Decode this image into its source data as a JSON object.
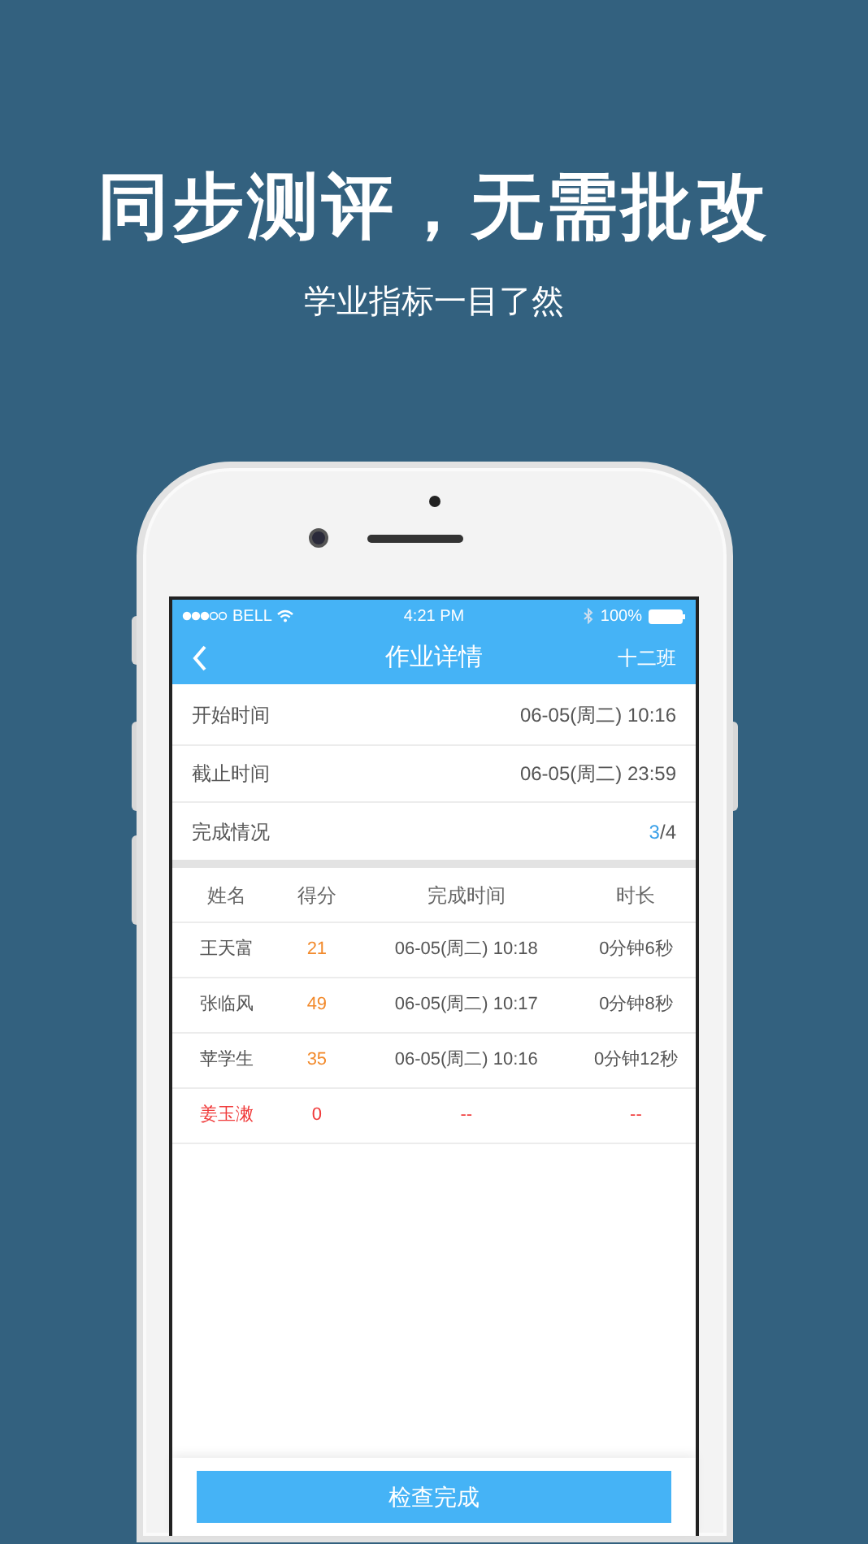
{
  "headline": "同步测评，无需批改",
  "subheadline": "学业指标一目了然",
  "status_bar": {
    "carrier": "BELL",
    "time": "4:21 PM",
    "battery": "100%"
  },
  "nav": {
    "title": "作业详情",
    "right": "十二班"
  },
  "info_rows": [
    {
      "label": "开始时间",
      "value": "06-05(周二) 10:16"
    },
    {
      "label": "截止时间",
      "value": "06-05(周二) 23:59"
    }
  ],
  "completion": {
    "label": "完成情况",
    "done": "3",
    "rest": "/4"
  },
  "table": {
    "columns": [
      "姓名",
      "得分",
      "完成时间",
      "时长"
    ],
    "rows": [
      {
        "submitted": true,
        "cells": [
          "王天富",
          "21",
          "06-05(周二) 10:18",
          "0分钟6秒"
        ]
      },
      {
        "submitted": true,
        "cells": [
          "张临风",
          "49",
          "06-05(周二) 10:17",
          "0分钟8秒"
        ]
      },
      {
        "submitted": true,
        "cells": [
          "苹学生",
          "35",
          "06-05(周二) 10:16",
          "0分钟12秒"
        ]
      },
      {
        "submitted": false,
        "cells": [
          "姜玉潄",
          "0",
          "--",
          "--"
        ]
      }
    ]
  },
  "bottom_button": "检查完成"
}
